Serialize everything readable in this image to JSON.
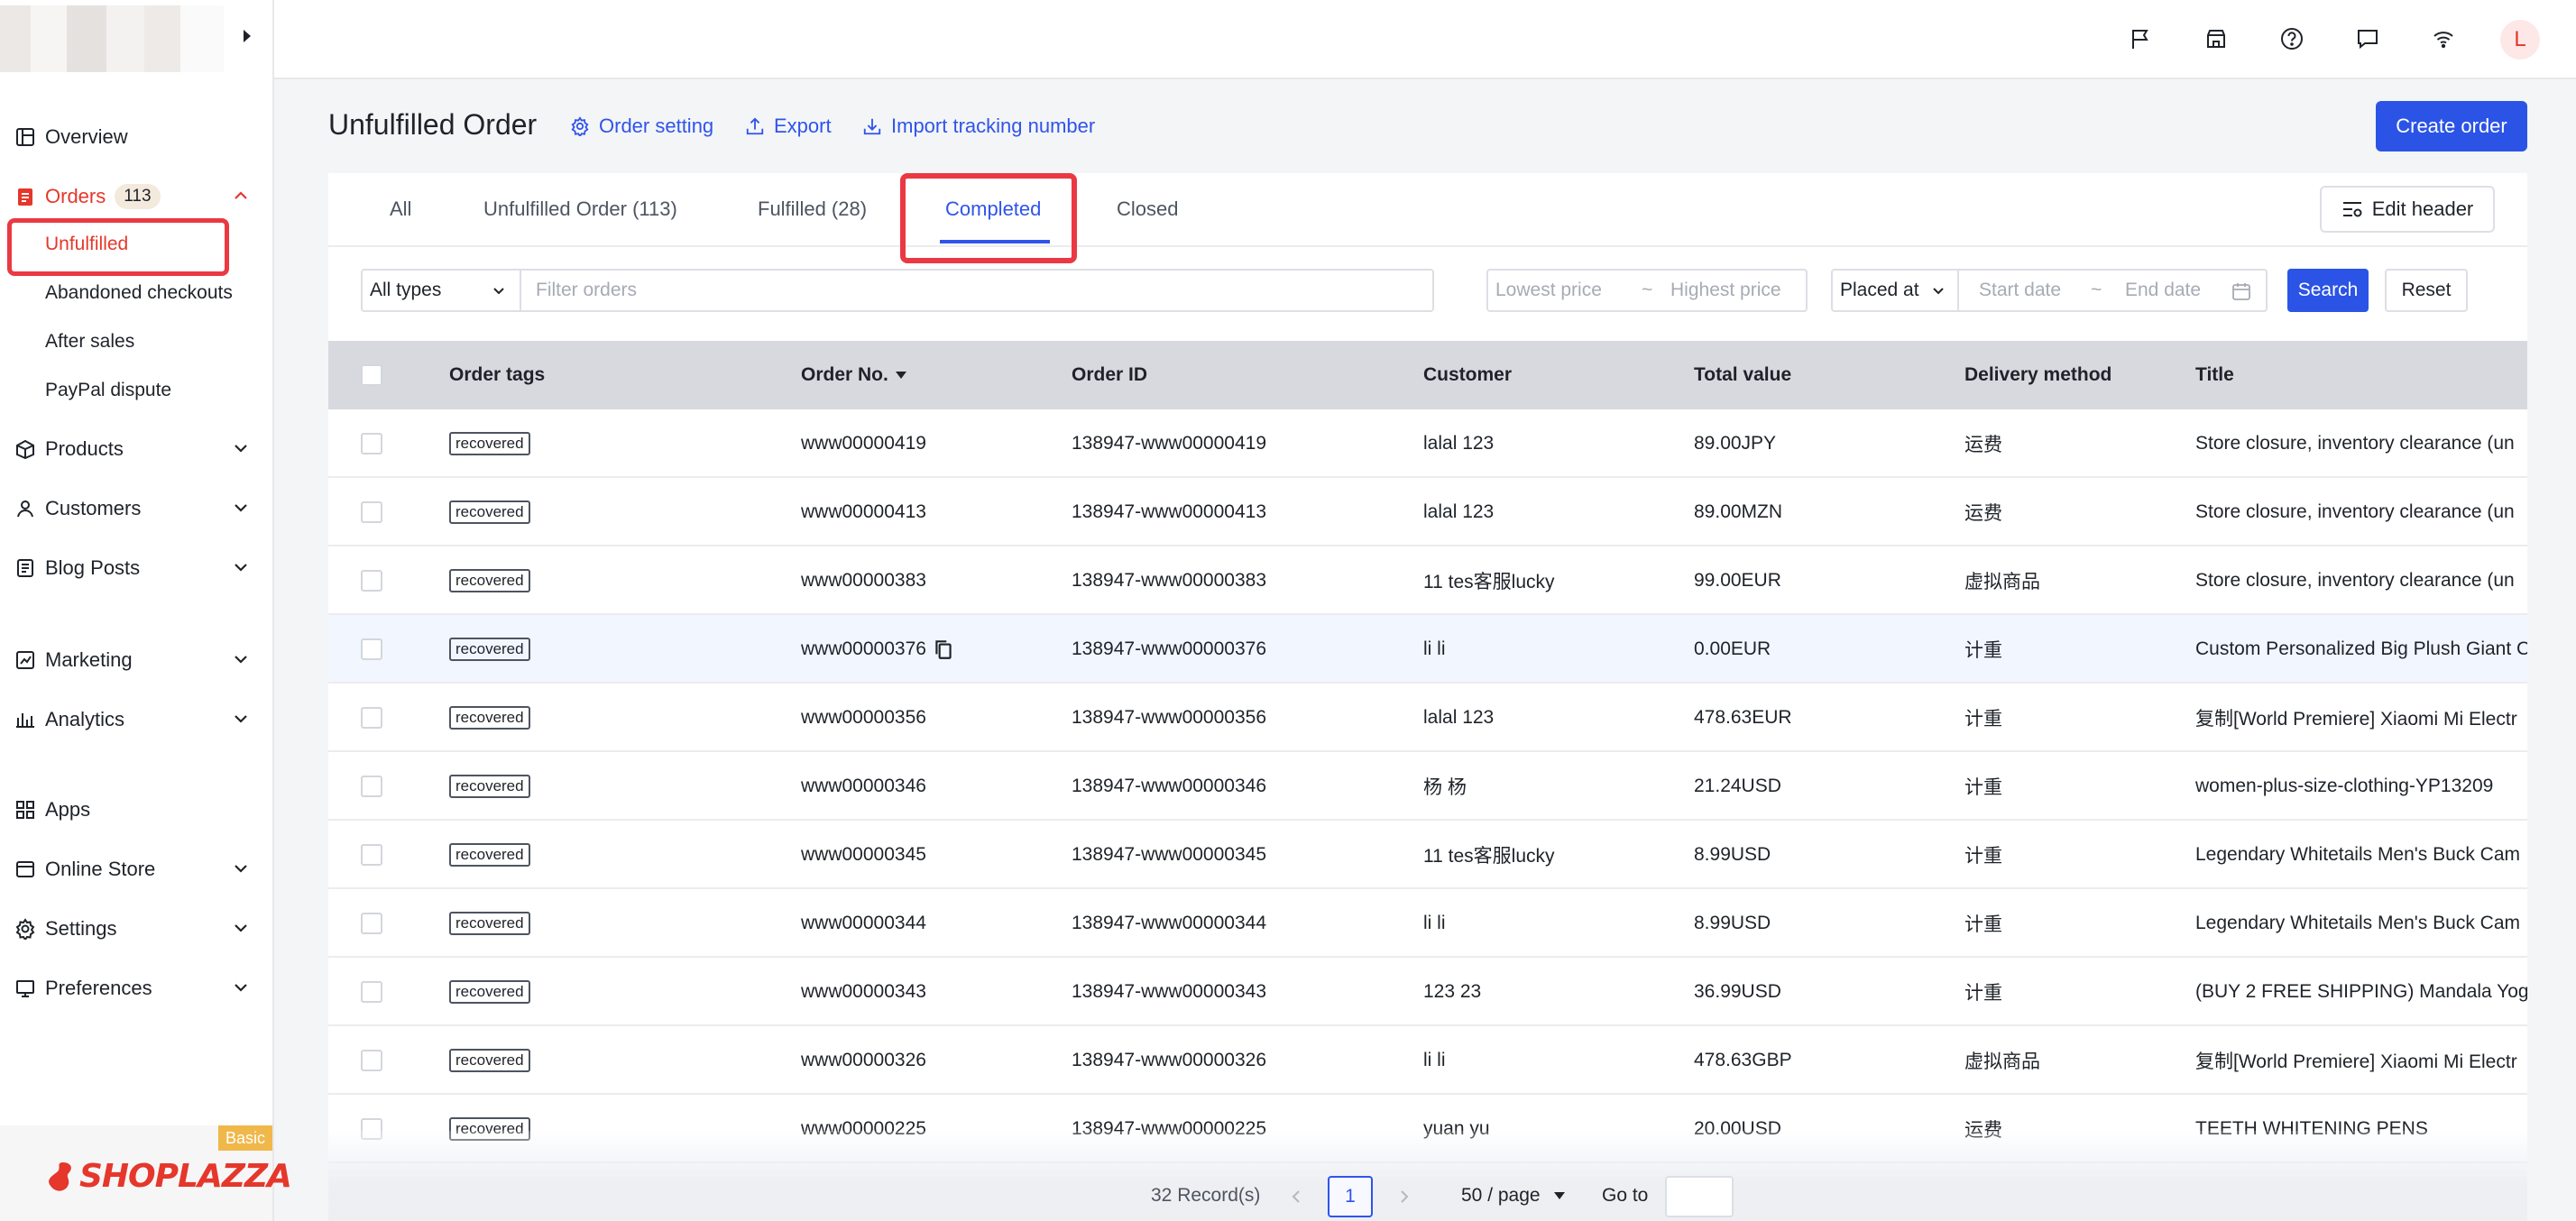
{
  "sidebar": {
    "items": [
      {
        "label": "Overview",
        "icon": "dashboard-icon"
      },
      {
        "label": "Orders",
        "badge": "113",
        "icon": "orders-icon"
      },
      {
        "label": "Products",
        "icon": "products-icon"
      },
      {
        "label": "Customers",
        "icon": "person-icon"
      },
      {
        "label": "Blog Posts",
        "icon": "blog-icon"
      },
      {
        "label": "Marketing",
        "icon": "marketing-icon"
      },
      {
        "label": "Analytics",
        "icon": "analytics-icon"
      },
      {
        "label": "Apps",
        "icon": "apps-icon"
      },
      {
        "label": "Online Store",
        "icon": "store-icon"
      },
      {
        "label": "Settings",
        "icon": "gear-icon"
      },
      {
        "label": "Preferences",
        "icon": "monitor-icon"
      }
    ],
    "order_sub": [
      "Unfulfilled",
      "Abandoned checkouts",
      "After sales",
      "PayPal dispute"
    ],
    "brand": "SHOPLAZZA",
    "plan": "Basic"
  },
  "topbar": {
    "avatar_initial": "L",
    "icons": [
      "flag-icon",
      "store-icon",
      "help-icon",
      "chat-icon",
      "wifi-icon"
    ]
  },
  "header": {
    "title": "Unfulfilled Order",
    "actions": [
      "Order setting",
      "Export",
      "Import tracking number"
    ],
    "create_label": "Create order"
  },
  "tabs": {
    "items": [
      "All",
      "Unfulfilled Order (113)",
      "Fulfilled (28)",
      "Completed",
      "Closed"
    ],
    "active_index": 3,
    "edit_header": "Edit header"
  },
  "filters": {
    "type_value": "All types",
    "search_placeholder": "Filter orders",
    "lowest_placeholder": "Lowest price",
    "highest_placeholder": "Highest price",
    "tilde": "~",
    "placed_value": "Placed at",
    "start_placeholder": "Start date",
    "end_placeholder": "End date",
    "search_label": "Search",
    "reset_label": "Reset"
  },
  "table": {
    "columns": [
      "Order tags",
      "Order No.",
      "Order ID",
      "Customer",
      "Total value",
      "Delivery method",
      "Title"
    ],
    "rows": [
      {
        "tag": "recovered",
        "no": "www00000419",
        "id": "138947-www00000419",
        "customer": "lalal 123",
        "total": "89.00JPY",
        "delivery": "运费",
        "title": "Store closure, inventory clearance (un"
      },
      {
        "tag": "recovered",
        "no": "www00000413",
        "id": "138947-www00000413",
        "customer": "lalal 123",
        "total": "89.00MZN",
        "delivery": "运费",
        "title": "Store closure, inventory clearance (un"
      },
      {
        "tag": "recovered",
        "no": "www00000383",
        "id": "138947-www00000383",
        "customer": "11 tes客服lucky",
        "total": "99.00EUR",
        "delivery": "虚拟商品",
        "title": "Store closure, inventory clearance (un"
      },
      {
        "tag": "recovered",
        "no": "www00000376",
        "id": "138947-www00000376",
        "customer": "li li",
        "total": "0.00EUR",
        "delivery": "计重",
        "title": "Custom Personalized Big Plush Giant C"
      },
      {
        "tag": "recovered",
        "no": "www00000356",
        "id": "138947-www00000356",
        "customer": "lalal 123",
        "total": "478.63EUR",
        "delivery": "计重",
        "title": "复制[World Premiere] Xiaomi Mi Electr"
      },
      {
        "tag": "recovered",
        "no": "www00000346",
        "id": "138947-www00000346",
        "customer": "杨 杨",
        "total": "21.24USD",
        "delivery": "计重",
        "title": "women-plus-size-clothing-YP13209"
      },
      {
        "tag": "recovered",
        "no": "www00000345",
        "id": "138947-www00000345",
        "customer": "11 tes客服lucky",
        "total": "8.99USD",
        "delivery": "计重",
        "title": "Legendary Whitetails Men's Buck Cam"
      },
      {
        "tag": "recovered",
        "no": "www00000344",
        "id": "138947-www00000344",
        "customer": "li li",
        "total": "8.99USD",
        "delivery": "计重",
        "title": "Legendary Whitetails Men's Buck Cam"
      },
      {
        "tag": "recovered",
        "no": "www00000343",
        "id": "138947-www00000343",
        "customer": "123 23",
        "total": "36.99USD",
        "delivery": "计重",
        "title": "(BUY 2 FREE SHIPPING) Mandala Yoga"
      },
      {
        "tag": "recovered",
        "no": "www00000326",
        "id": "138947-www00000326",
        "customer": "li li",
        "total": "478.63GBP",
        "delivery": "虚拟商品",
        "title": "复制[World Premiere] Xiaomi Mi Electr"
      },
      {
        "tag": "recovered",
        "no": "www00000225",
        "id": "138947-www00000225",
        "customer": "yuan yu",
        "total": "20.00USD",
        "delivery": "运费",
        "title": "TEETH WHITENING PENS"
      }
    ]
  },
  "pagination": {
    "records": "32 Record(s)",
    "current_page": "1",
    "page_size": "50 / page",
    "goto_label": "Go to"
  }
}
